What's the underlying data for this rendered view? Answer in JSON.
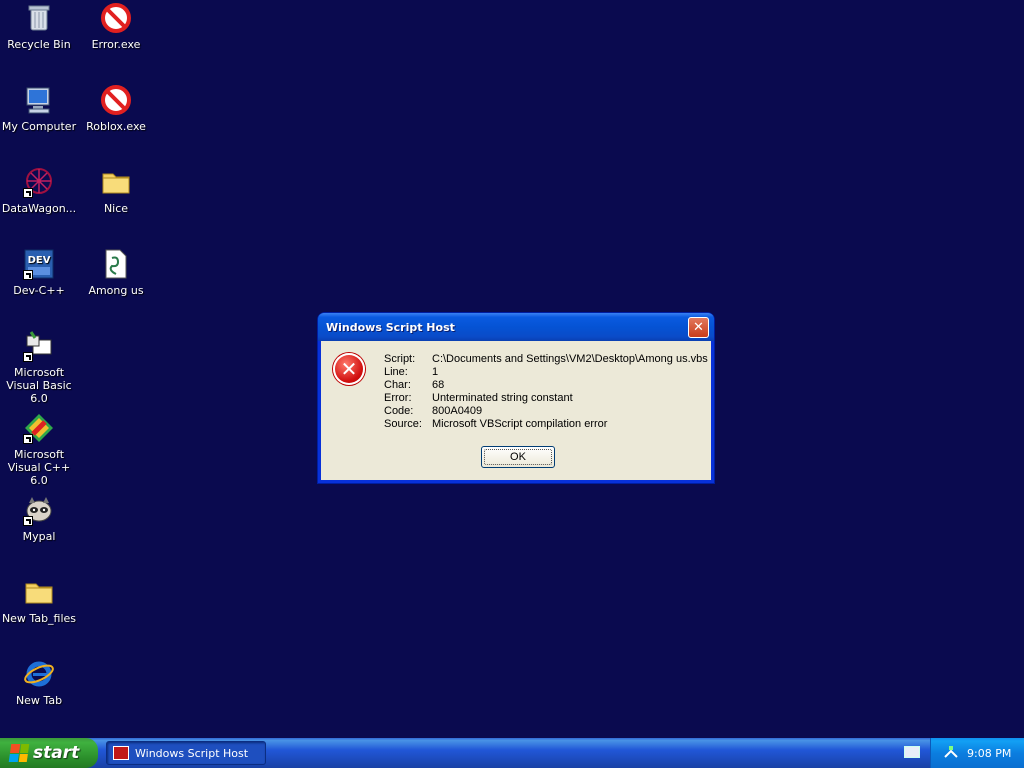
{
  "desktop": {
    "icons": [
      {
        "label": "Recycle Bin",
        "icon": "recycle-bin-icon"
      },
      {
        "label": "Error.exe",
        "icon": "no-entry-icon"
      },
      {
        "label": "My Computer",
        "icon": "computer-icon"
      },
      {
        "label": "Roblox.exe",
        "icon": "no-entry-icon"
      },
      {
        "label": "DataWagon...",
        "icon": "web-icon"
      },
      {
        "label": "Nice",
        "icon": "folder-icon"
      },
      {
        "label": "Dev-C++",
        "icon": "dev-cpp-icon"
      },
      {
        "label": "Among us",
        "icon": "script-file-icon"
      },
      {
        "label": "Microsoft Visual Basic 6.0",
        "icon": "vb6-icon"
      },
      {
        "label": "Microsoft Visual C++ 6.0",
        "icon": "vc6-icon"
      },
      {
        "label": "Mypal",
        "icon": "raccoon-icon"
      },
      {
        "label": "New Tab_files",
        "icon": "folder-icon"
      },
      {
        "label": "New Tab",
        "icon": "internet-explorer-icon"
      }
    ]
  },
  "dialog": {
    "title": "Windows Script Host",
    "fields": {
      "script": {
        "key": "Script:",
        "value": "C:\\Documents and Settings\\VM2\\Desktop\\Among us.vbs"
      },
      "line": {
        "key": "Line:",
        "value": "1"
      },
      "char": {
        "key": "Char:",
        "value": "68"
      },
      "error": {
        "key": "Error:",
        "value": "Unterminated string constant"
      },
      "code": {
        "key": "Code:",
        "value": "800A0409"
      },
      "source": {
        "key": "Source:",
        "value": "Microsoft VBScript compilation error"
      }
    },
    "ok_label": "OK"
  },
  "taskbar": {
    "start_label": "start",
    "task_label": "Windows Script Host",
    "clock": "9:08 PM"
  }
}
